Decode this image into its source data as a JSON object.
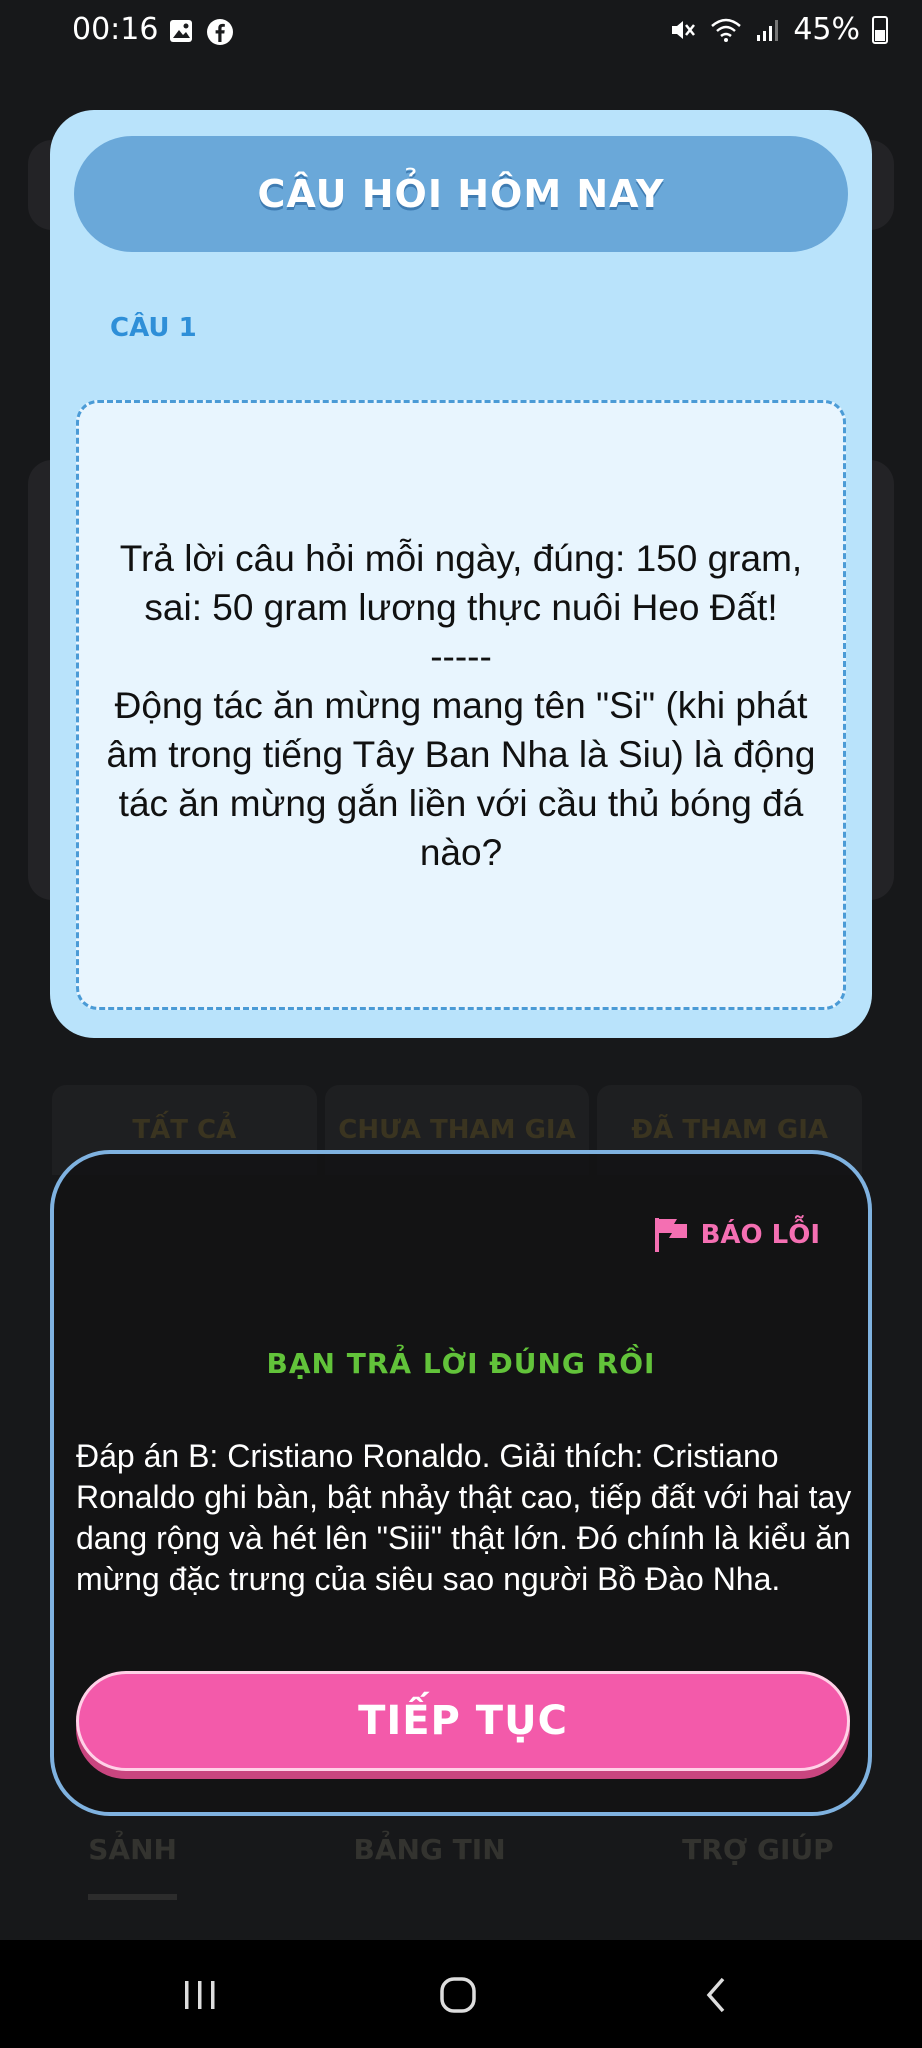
{
  "status_bar": {
    "time": "00:16",
    "battery_percent": "45%"
  },
  "question_card": {
    "title": "CÂU HỎI HÔM NAY",
    "question_number": "CÂU 1",
    "question_text": "Trả lời câu hỏi mỗi ngày, đúng: 150 gram, sai: 50 gram lương thực nuôi Heo Đất!\n-----\nĐộng tác ăn mừng mang tên \"Si\" (khi phát âm trong tiếng Tây Ban Nha là Siu) là động tác ăn mừng gắn liền với cầu thủ bóng đá nào?"
  },
  "answer_panel": {
    "report_label": "BÁO LỖI",
    "result_text": "BẠN TRẢ LỜI ĐÚNG RỒI",
    "explanation": "Đáp án B: Cristiano Ronaldo. Giải thích: Cristiano Ronaldo ghi bàn, bật nhảy thật cao, tiếp đất với hai tay dang rộng và hét lên \"Siii\" thật lớn. Đó chính là kiểu ăn mừng đặc trưng của siêu sao người Bồ Đào Nha.",
    "continue_label": "TIẾP TỤC"
  },
  "background": {
    "tabs": [
      "TẤT CẢ",
      "CHƯA THAM GIA",
      "ĐÃ THAM GIA"
    ],
    "nav": [
      "SẢNH",
      "BẢNG TIN",
      "TRỢ GIÚP"
    ]
  },
  "colors": {
    "card_bg": "#b9e3fb",
    "header_bg": "#6aa8d9",
    "accent_pink": "#f35aaa",
    "success_green": "#62c33a"
  }
}
